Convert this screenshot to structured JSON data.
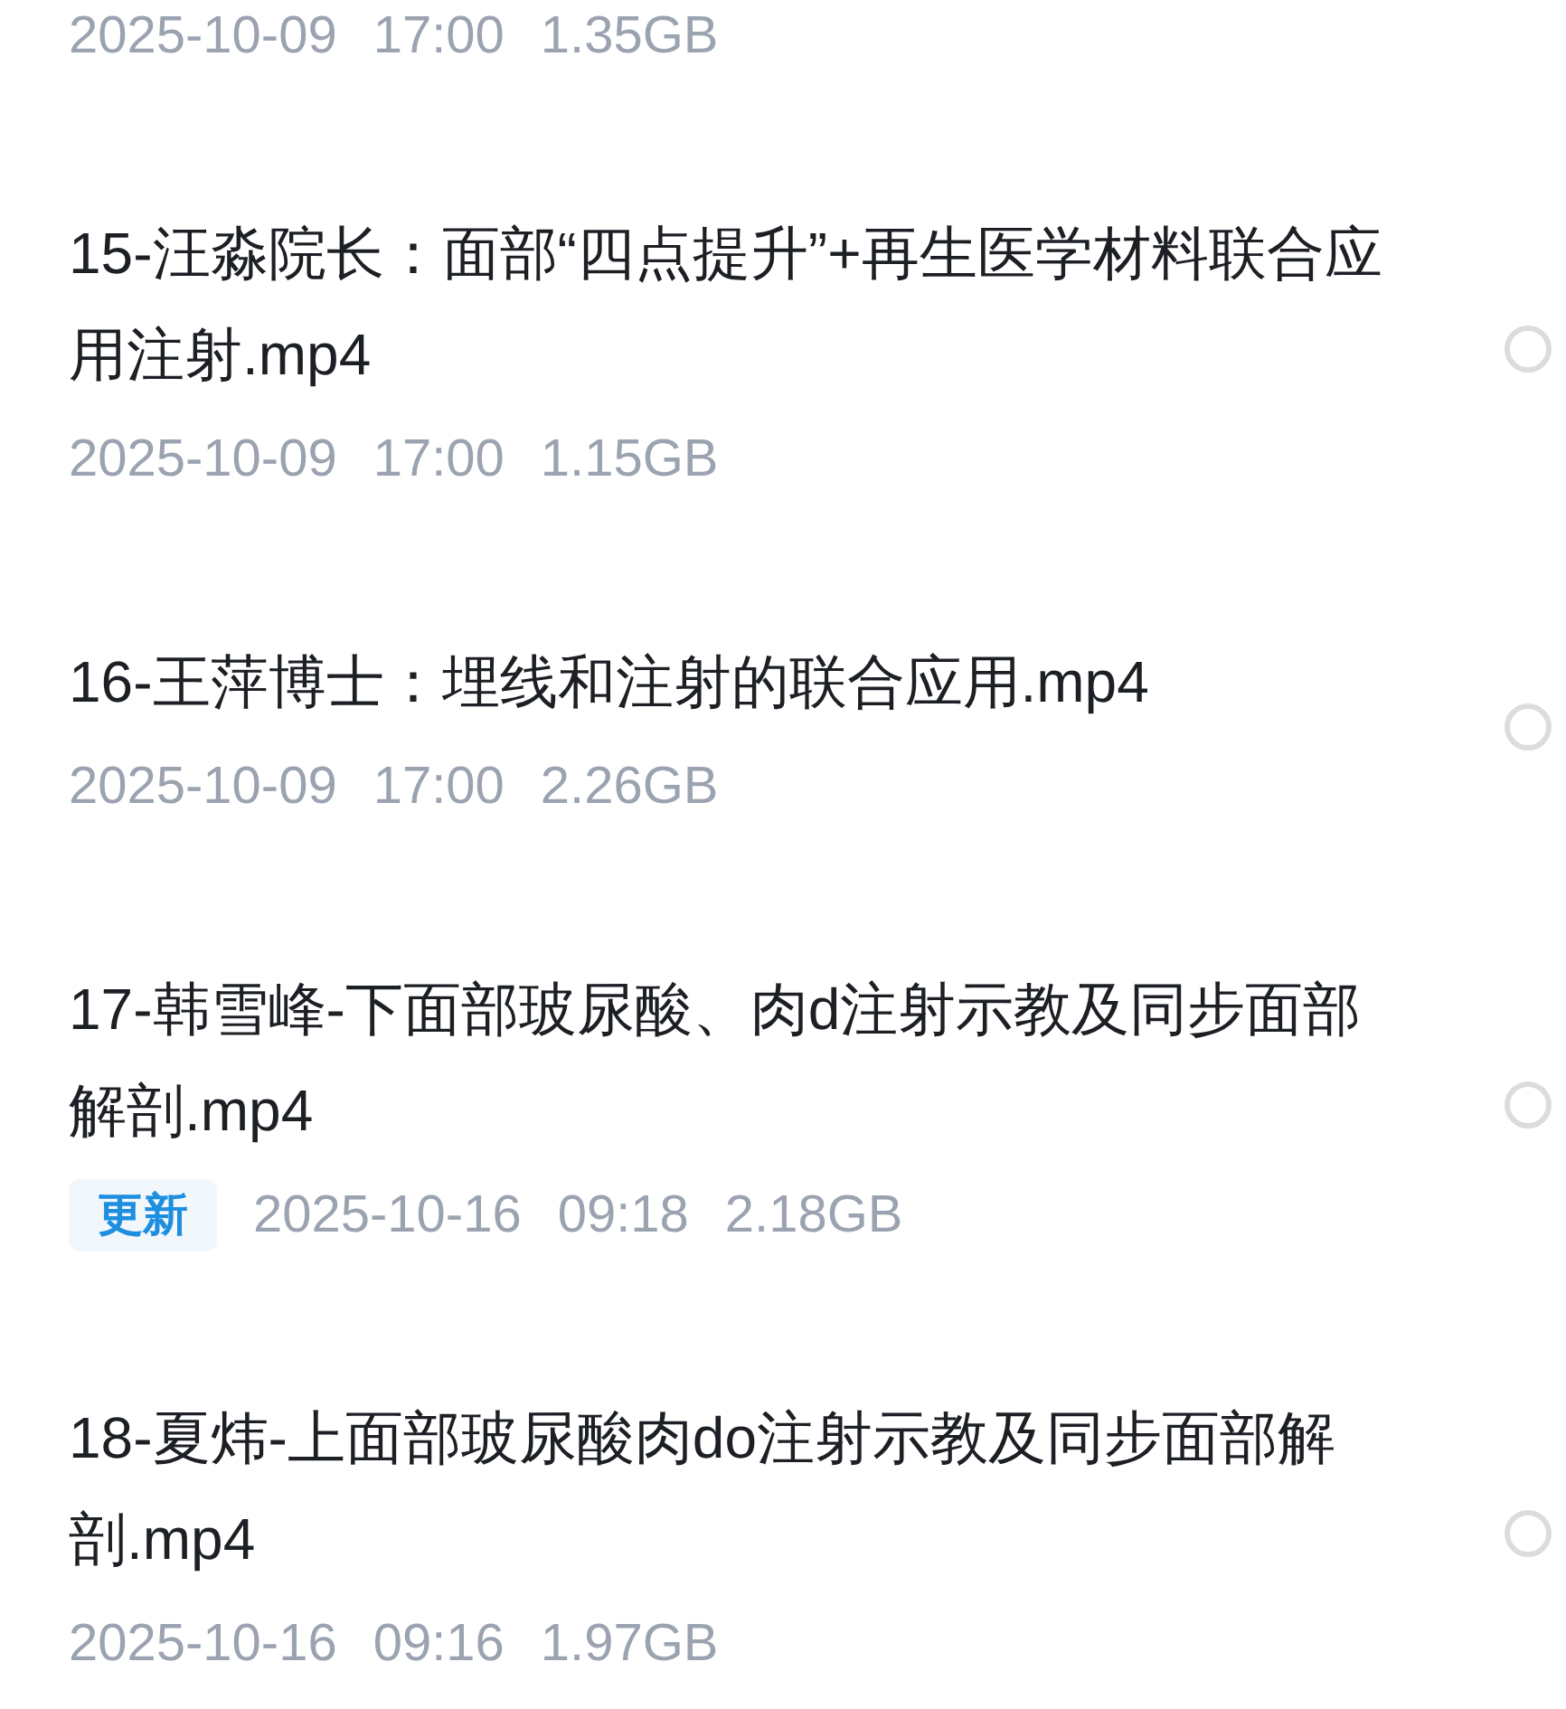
{
  "top_meta": {
    "date": "2025-10-09",
    "time": "17:00",
    "size": "1.35GB"
  },
  "files": [
    {
      "title": "15-汪淼院长：面部“四点提升”+再生医学材料联合应用注射.mp4",
      "date": "2025-10-09",
      "time": "17:00",
      "size": "1.15GB",
      "selected": false
    },
    {
      "title": "16-王萍博士：埋线和注射的联合应用.mp4",
      "date": "2025-10-09",
      "time": "17:00",
      "size": "2.26GB",
      "selected": false
    },
    {
      "title": "17-韩雪峰-下面部玻尿酸、肉d注射示教及同步面部解剖.mp4",
      "badge": "更新",
      "date": "2025-10-16",
      "time": "09:18",
      "size": "2.18GB",
      "selected": false
    },
    {
      "title": "18-夏炜-上面部玻尿酸肉do注射示教及同步面部解剖.mp4",
      "date": "2025-10-16",
      "time": "09:16",
      "size": "1.97GB",
      "selected": false
    }
  ]
}
